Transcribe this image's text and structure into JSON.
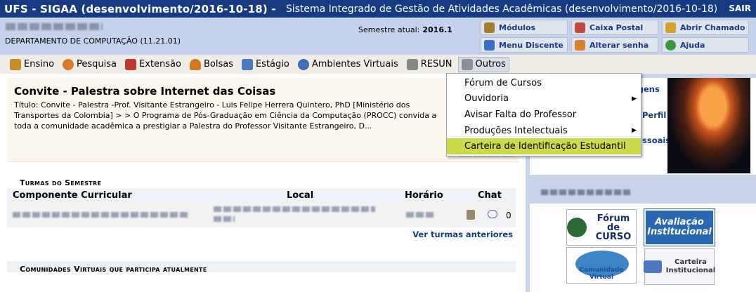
{
  "topbar": {
    "system": "UFS - SIGAA (desenvolvimento/2016-10-18) -",
    "full_name": "Sistema Integrado de Gestão de Atividades Acadêmicas (desenvolvimento/2016-10-18)",
    "logout": "SAIR"
  },
  "info": {
    "department": "DEPARTAMENTO DE COMPUTAÇÃO (11.21.01)",
    "semester_label": "Semestre atual:",
    "semester_value": "2016.1"
  },
  "shortcuts": [
    {
      "label": "Módulos",
      "icon": "modules-icon",
      "color": "#a67c2e"
    },
    {
      "label": "Caixa Postal",
      "icon": "mailbox-icon",
      "color": "#c14a3a"
    },
    {
      "label": "Abrir Chamado",
      "icon": "wrench-icon",
      "color": "#d6a32a"
    },
    {
      "label": "Menu Discente",
      "icon": "menu-icon",
      "color": "#3a6fc4"
    },
    {
      "label": "Alterar senha",
      "icon": "user-key-icon",
      "color": "#d9822b"
    },
    {
      "label": "Ajuda",
      "icon": "help-icon",
      "color": "#3a9a3a"
    }
  ],
  "menu": [
    {
      "label": "Ensino",
      "icon": "books-icon",
      "color": "#c98a2b"
    },
    {
      "label": "Pesquisa",
      "icon": "flask-icon",
      "color": "#d97a2a"
    },
    {
      "label": "Extensão",
      "icon": "hands-heart-icon",
      "color": "#c0392b"
    },
    {
      "label": "Bolsas",
      "icon": "person-icon",
      "color": "#d07a1e"
    },
    {
      "label": "Estágio",
      "icon": "id-card-icon",
      "color": "#4a7abf"
    },
    {
      "label": "Ambientes Virtuais",
      "icon": "globe-icon",
      "color": "#3f6fb8"
    },
    {
      "label": "RESUN",
      "icon": "document-icon",
      "color": "#888888"
    },
    {
      "label": "Outros",
      "icon": "printer-icon",
      "color": "#8a8f9a"
    }
  ],
  "dropdown": [
    {
      "label": "Fórum de Cursos",
      "submenu": false
    },
    {
      "label": "Ouvidoria",
      "submenu": true
    },
    {
      "label": "Avisar Falta do Professor",
      "submenu": false
    },
    {
      "label": "Produções Intelectuais",
      "submenu": true
    },
    {
      "label": "Carteira de Identificação Estudantil",
      "submenu": false
    }
  ],
  "dropdown_arrow": "▶",
  "news": {
    "title": "Convite - Palestra sobre Internet das Coisas",
    "body": "Título: Convite - Palestra -Prof. Visitante Estrangeiro - Luis Felipe Herrera Quintero, PhD [Ministério dos Transportes da Colombia] > > O Programa de Pós-Graduação em Ciência da Computação (PROCC) convida a toda a comunidade acadêmica a prestigiar a Palestra do Professor Visitante Estrangeiro, D..."
  },
  "turmas": {
    "section_title": "Turmas do Semestre",
    "columns": [
      "Componente Curricular",
      "Local",
      "Horário",
      "Chat"
    ],
    "chat_count": "0",
    "more_link": "Ver turmas anteriores"
  },
  "comunidades": {
    "section_title": "Comunidades Virtuais que participa atualmente"
  },
  "right": {
    "links": [
      "agens",
      "Perfil",
      "ssoais"
    ],
    "badges": {
      "forum": "Fórum de CURSO",
      "avaliacao": "Avaliação Institucional",
      "comunidade": "Comunidade Virtual",
      "carteira": "Carteira Institucional"
    }
  },
  "colors": {
    "topbar": "#173a82",
    "info_band": "#c4d3eb",
    "menu_bar": "#f0ede6",
    "highlight": "#ccd948"
  }
}
